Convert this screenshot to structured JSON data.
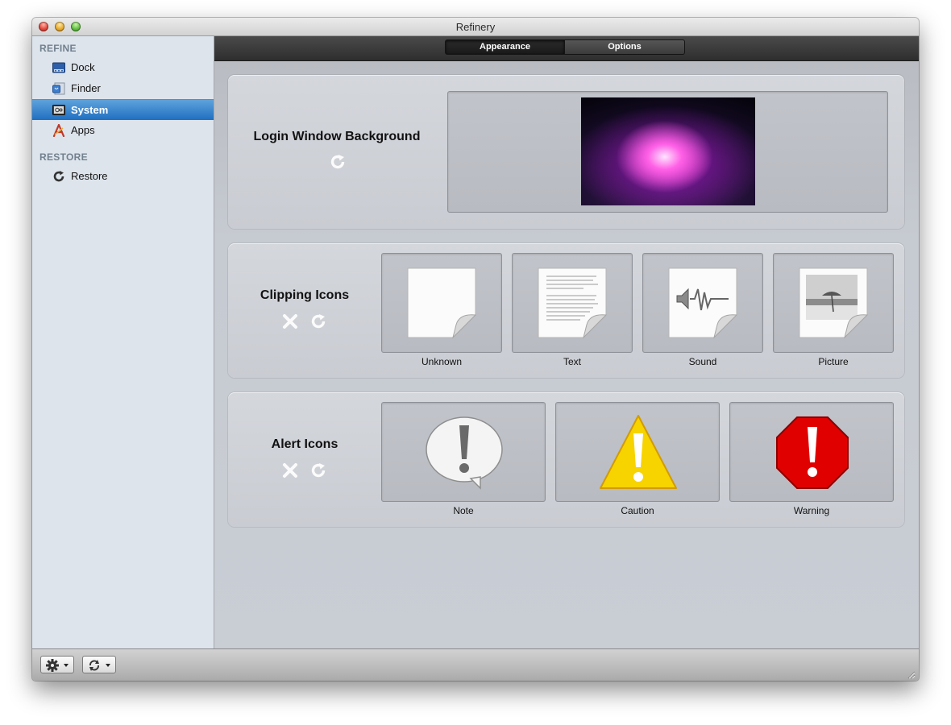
{
  "window": {
    "title": "Refinery"
  },
  "sidebar": {
    "refine_heading": "REFINE",
    "restore_heading": "RESTORE",
    "items": [
      {
        "label": "Dock",
        "icon": "dock-icon"
      },
      {
        "label": "Finder",
        "icon": "finder-icon"
      },
      {
        "label": "System",
        "icon": "system-icon",
        "selected": true
      },
      {
        "label": "Apps",
        "icon": "apps-icon"
      },
      {
        "label": "Restore",
        "icon": "restore-icon"
      }
    ]
  },
  "tabs": [
    {
      "label": "Appearance",
      "selected": true
    },
    {
      "label": "Options",
      "selected": false
    }
  ],
  "sections": {
    "login": {
      "title": "Login Window Background"
    },
    "clipping": {
      "title": "Clipping Icons",
      "items": [
        "Unknown",
        "Text",
        "Sound",
        "Picture"
      ]
    },
    "alert": {
      "title": "Alert Icons",
      "items": [
        "Note",
        "Caution",
        "Warning"
      ]
    }
  },
  "colors": {
    "selection": "#1f6fc1",
    "caution": "#f7d300",
    "warning": "#e10000"
  }
}
